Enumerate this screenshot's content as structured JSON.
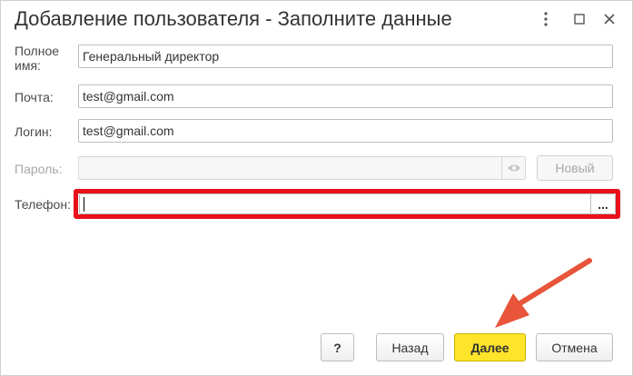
{
  "window": {
    "title": "Добавление пользователя - Заполните данные",
    "menu_icon": "more-vertical-icon",
    "maximize_icon": "maximize-icon",
    "close_icon": "close-icon"
  },
  "form": {
    "full_name": {
      "label": "Полное\nимя:",
      "value": "Генеральный директор"
    },
    "email": {
      "label": "Почта:",
      "value": "test@gmail.com"
    },
    "login": {
      "label": "Логин:",
      "value": "test@gmail.com"
    },
    "password": {
      "label": "Пароль:",
      "value": "",
      "toggle_icon": "eye-icon",
      "new_label": "Новый"
    },
    "phone": {
      "label": "Телефон:",
      "value": "",
      "select_label": "..."
    }
  },
  "footer": {
    "help_label": "?",
    "back_label": "Назад",
    "next_label": "Далее",
    "cancel_label": "Отмена"
  },
  "colors": {
    "highlight": "#e8101a",
    "arrow": "#e8553a",
    "primary_button": "#ffe42a"
  }
}
